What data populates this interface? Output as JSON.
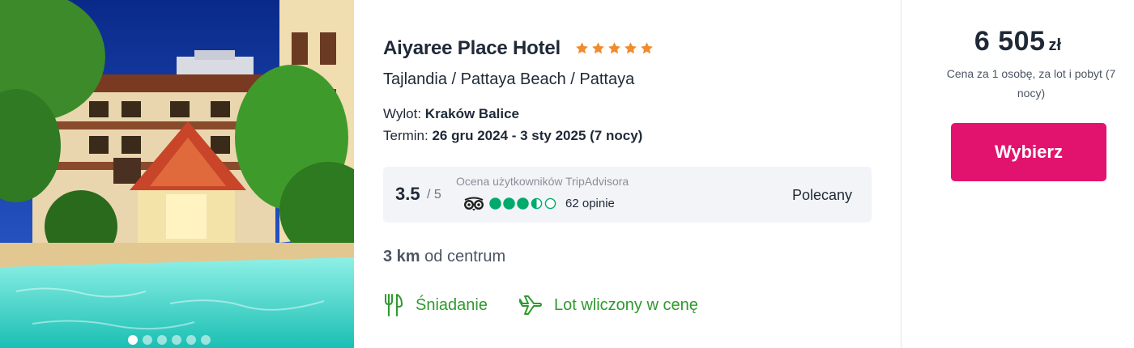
{
  "hotel": {
    "name": "Aiyaree Place Hotel",
    "stars": 5,
    "location": "Tajlandia / Pattaya Beach / Pattaya",
    "departure_label": "Wylot: ",
    "departure_value": "Kraków Balice",
    "term_label": "Termin: ",
    "term_value": "26 gru 2024 - 3 sty 2025 (7 nocy)"
  },
  "photo": {
    "slides_count": 6,
    "active_slide": 1
  },
  "rating": {
    "score": "3.5",
    "max": "/ 5",
    "source_label": "Ocena użytkowników TripAdvisora",
    "bubbles": 3.5,
    "reviews": "62 opinie",
    "verdict": "Polecany"
  },
  "distance": {
    "value": "3 km",
    "suffix": " od centrum"
  },
  "amenities": [
    {
      "icon": "fork-knife-icon",
      "label": "Śniadanie"
    },
    {
      "icon": "airplane-icon",
      "label": "Lot wliczony w cenę"
    }
  ],
  "price": {
    "amount": "6 505",
    "currency": "zł",
    "note": "Cena za 1 osobę, za lot i pobyt (7 nocy)",
    "button_label": "Wybierz"
  },
  "colors": {
    "star": "#f28a2e",
    "tripadvisor_green": "#00aa6c",
    "amenity_green": "#2e9a2e",
    "cta": "#e2136e"
  }
}
